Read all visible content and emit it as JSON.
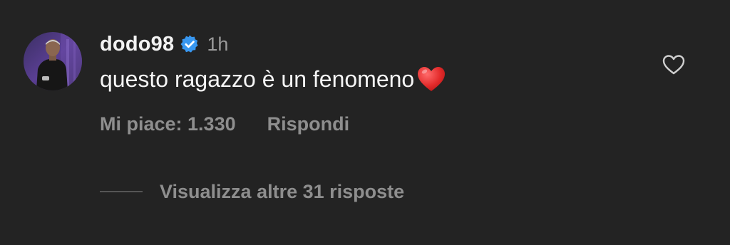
{
  "comment": {
    "username": "dodo98",
    "verified": true,
    "time": "1h",
    "text": "questo ragazzo è un fenomeno",
    "emoji": "red-heart-emoji",
    "likes_label": "Mi piace: 1.330",
    "reply_label": "Rispondi",
    "view_replies_label": "Visualizza altre 31 risposte"
  },
  "colors": {
    "background": "#232323",
    "verified_badge": "#3897f0",
    "heart": "#e0282e",
    "secondary_text": "#8e8e8e"
  }
}
